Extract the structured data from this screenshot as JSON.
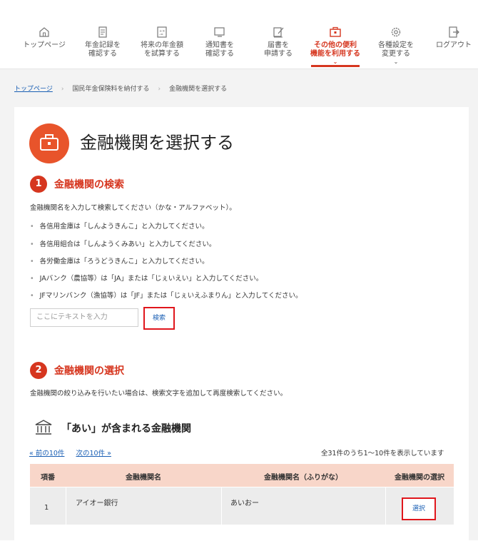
{
  "nav": {
    "items": [
      {
        "label1": "トップページ",
        "label2": ""
      },
      {
        "label1": "年金記録を",
        "label2": "確認する"
      },
      {
        "label1": "将来の年金額",
        "label2": "を試算する"
      },
      {
        "label1": "通知書を",
        "label2": "確認する"
      },
      {
        "label1": "届書を",
        "label2": "申請する"
      },
      {
        "label1": "その他の便利",
        "label2": "機能を利用する"
      },
      {
        "label1": "各種設定を",
        "label2": "変更する"
      },
      {
        "label1": "ログアウト",
        "label2": ""
      }
    ],
    "chevron": "⌄"
  },
  "breadcrumb": {
    "home": "トップページ",
    "mid": "国民年金保険料を納付する",
    "current": "金融機関を選択する",
    "sep": "›"
  },
  "page": {
    "title": "金融機関を選択する"
  },
  "section1": {
    "number": "1",
    "title": "金融機関の検索",
    "intro": "金融機関名を入力して検索してください（かな・アルファベット）。",
    "bullets": [
      "各信用金庫は「しんようきんこ」と入力してください。",
      "各信用組合は「しんようくみあい」と入力してください。",
      "各労働金庫は「ろうどうきんこ」と入力してください。",
      "JAバンク（農協等）は「JA」または「じぇいえい」と入力してください。",
      "JFマリンバンク（漁協等）は「JF」または「じぇいえふまりん」と入力してください。"
    ],
    "placeholder": "ここにテキストを入力",
    "search_label": "検索"
  },
  "section2": {
    "number": "2",
    "title": "金融機関の選択",
    "intro": "金融機関の絞り込みを行いたい場合は、検索文字を追加して再度検索してください。",
    "results_title": "「あい」が含まれる金融機関",
    "prev": "« 前の10件",
    "next": "次の10件 »",
    "count": "全31件のうち1～10件を表示しています",
    "headers": [
      "項番",
      "金融機関名",
      "金融機関名（ふりがな）",
      "金融機関の選択"
    ],
    "rows": [
      {
        "no": "1",
        "name": "アイオー銀行",
        "kana": "あいおー",
        "action": "選択"
      }
    ]
  },
  "colors": {
    "accent": "#d6361f",
    "highlight": "#e0161c",
    "link": "#1a5fb4"
  }
}
